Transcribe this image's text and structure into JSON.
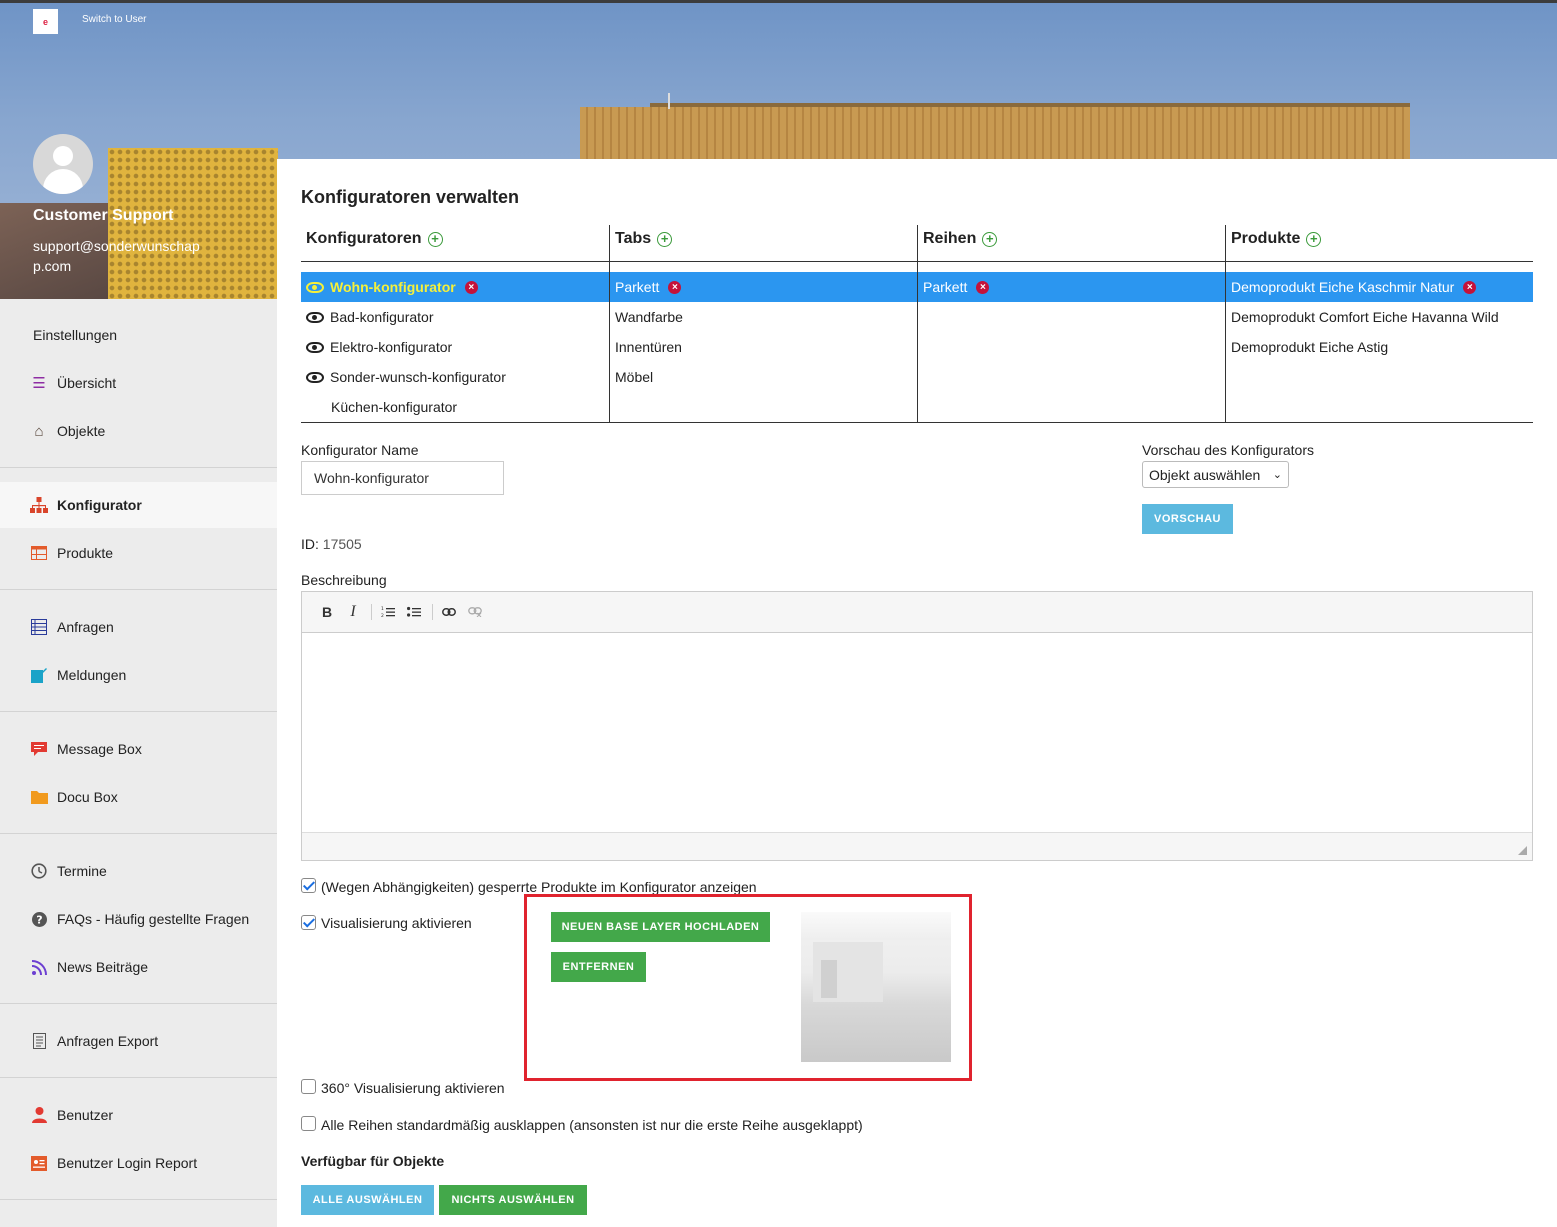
{
  "header": {
    "logo_text": "e",
    "switch_user": "Switch to User"
  },
  "user": {
    "name": "Customer Support",
    "email": "support@sonderwunschapp.com"
  },
  "sidebar": {
    "section_label": "Einstellungen",
    "items": [
      {
        "label": "Übersicht",
        "icon": "menu-lines-icon",
        "color": "#8e2da3"
      },
      {
        "label": "Objekte",
        "icon": "home-icon",
        "color": "#5b4a3f"
      },
      {
        "label": "Konfigurator",
        "icon": "sitemap-icon",
        "color": "#d9452b",
        "active": true
      },
      {
        "label": "Produkte",
        "icon": "grid-table-icon",
        "color": "#e35b2b"
      },
      {
        "label": "Anfragen",
        "icon": "list-table-icon",
        "color": "#2a3b9a"
      },
      {
        "label": "Meldungen",
        "icon": "edit-icon",
        "color": "#1aa3c8"
      },
      {
        "label": "Message Box",
        "icon": "chat-icon",
        "color": "#e23a32"
      },
      {
        "label": "Docu Box",
        "icon": "folder-icon",
        "color": "#f19a1e"
      },
      {
        "label": "Termine",
        "icon": "clock-icon",
        "color": "#555555"
      },
      {
        "label": "FAQs - Häufig gestellte Fragen",
        "icon": "question-icon",
        "color": "#555555"
      },
      {
        "label": "News Beiträge",
        "icon": "rss-icon",
        "color": "#6c3fd1"
      },
      {
        "label": "Anfragen Export",
        "icon": "document-icon",
        "color": "#555555"
      },
      {
        "label": "Benutzer",
        "icon": "user-icon",
        "color": "#e23a32"
      },
      {
        "label": "Benutzer Login Report",
        "icon": "id-card-icon",
        "color": "#e35b2b"
      }
    ]
  },
  "main": {
    "title": "Konfiguratoren verwalten",
    "columns": {
      "konfiguratoren": {
        "header": "Konfiguratoren",
        "items": [
          "Wohn-konfigurator",
          "Bad-konfigurator",
          "Elektro-konfigurator",
          "Sonder-wunsch-konfigurator",
          "Küchen-konfigurator"
        ]
      },
      "tabs": {
        "header": "Tabs",
        "items": [
          "Parkett",
          "Wandfarbe",
          "Innentüren",
          "Möbel"
        ]
      },
      "reihen": {
        "header": "Reihen",
        "items": [
          "Parkett"
        ]
      },
      "produkte": {
        "header": "Produkte",
        "items": [
          "Demoprodukt Eiche Kaschmir Natur",
          "Demoprodukt Comfort Eiche Havanna Wild",
          "Demoprodukt Eiche Astig"
        ]
      }
    },
    "form": {
      "name_label": "Konfigurator Name",
      "name_value": "Wohn-konfigurator",
      "preview_label": "Vorschau des Konfigurators",
      "preview_select": "Objekt auswählen",
      "preview_button": "VORSCHAU",
      "id_label": "ID:",
      "id_value": "17505",
      "description_label": "Beschreibung",
      "checkbox_locked": "(Wegen Abhängigkeiten) gesperrte Produkte im Konfigurator anzeigen",
      "checkbox_visual": "Visualisierung aktivieren",
      "upload_button": "NEUEN BASE LAYER HOCHLADEN",
      "remove_button": "ENTFERNEN",
      "checkbox_360": "360° Visualisierung aktivieren",
      "checkbox_rows": "Alle Reihen standardmäßig ausklappen (ansonsten ist nur die erste Reihe ausgeklappt)",
      "available_title": "Verfügbar für Objekte",
      "select_all": "ALLE AUSWÄHLEN",
      "select_none": "NICHTS AUSWÄHLEN"
    }
  }
}
